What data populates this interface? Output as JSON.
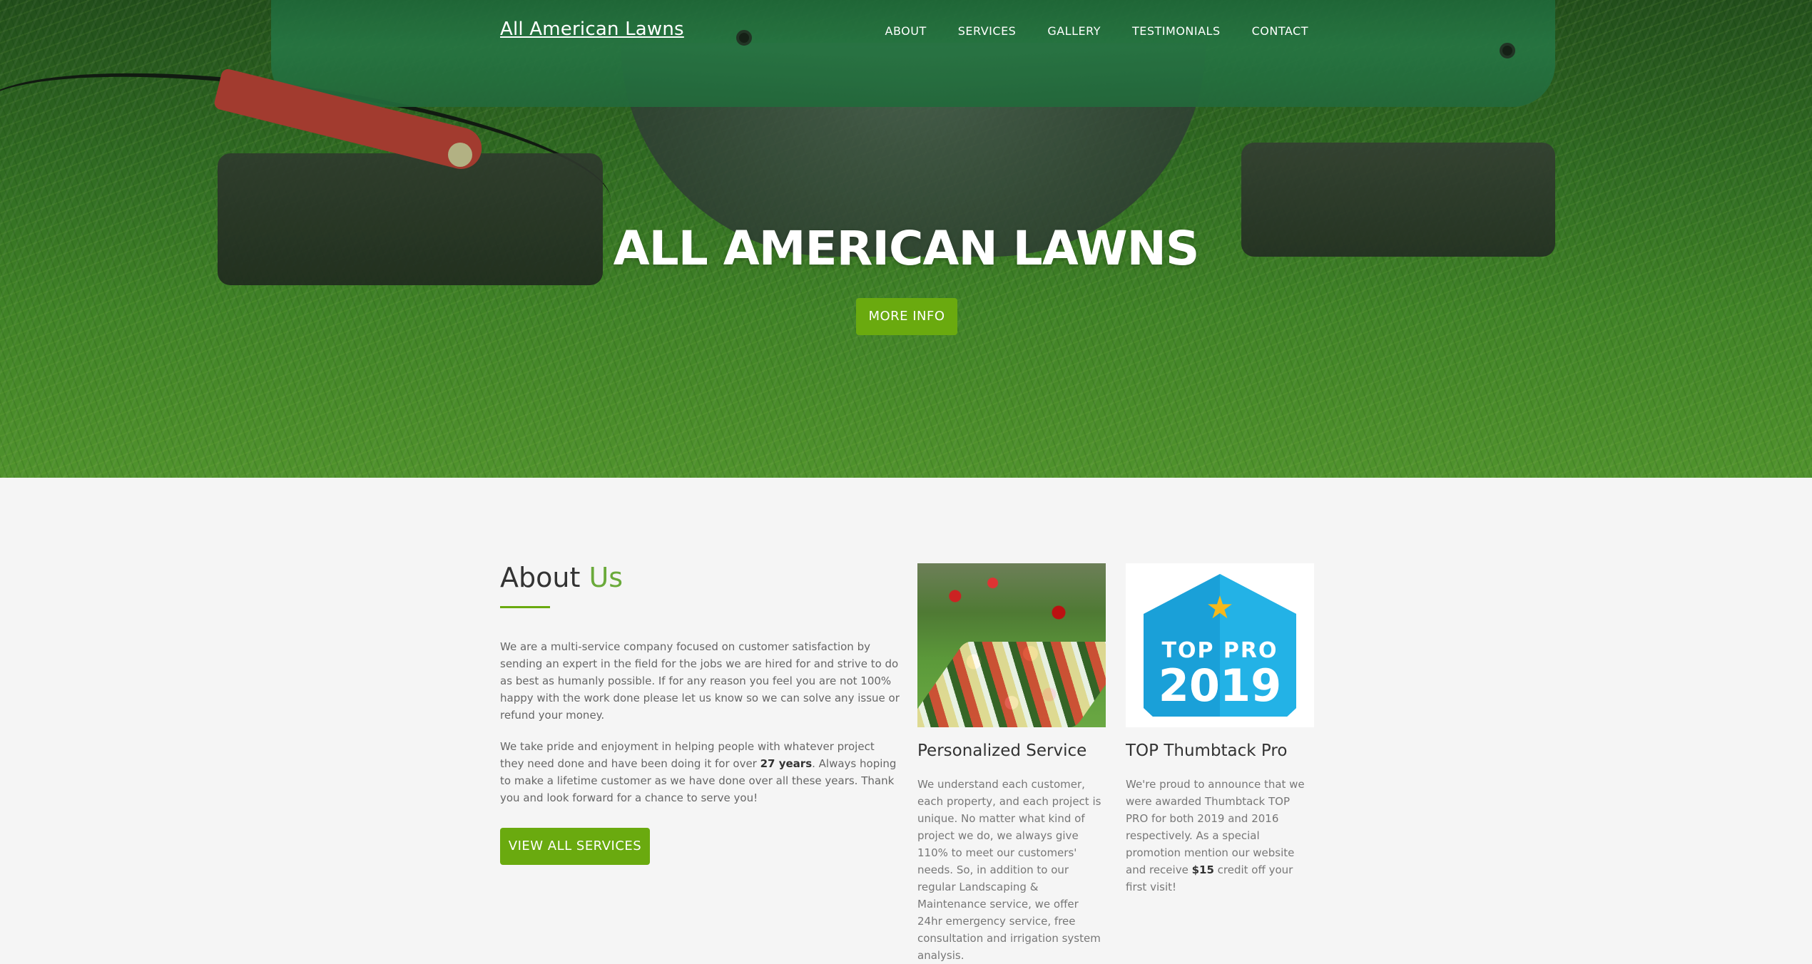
{
  "nav": {
    "brand": "All American Lawns",
    "links": [
      "ABOUT",
      "SERVICES",
      "GALLERY",
      "TESTIMONIALS",
      "CONTACT"
    ]
  },
  "hero": {
    "title": "ALL AMERICAN LAWNS",
    "button": "MORE INFO"
  },
  "about": {
    "heading_main": "About",
    "heading_accent": "Us",
    "p1": "We are a multi-service company focused on customer satisfaction by sending an expert in the field for the jobs we are hired for and strive to do as best as humanly possible. If for any reason you feel you are not 100% happy with the work done please let us know so we can solve any issue or refund your money.",
    "p2_before": "We take pride and enjoyment in helping people with whatever project they need done and have been doing it for over ",
    "p2_bold": "27 years",
    "p2_after": ". Always hoping to make a lifetime customer as we have done over all these years. Thank you and look forward for a chance to serve you!",
    "button": "VIEW ALL SERVICES"
  },
  "cards": [
    {
      "title": "Personalized Service",
      "text": "We understand each customer, each property, and each project is unique. No matter what kind of project we do, we always give 110% to meet our customers' needs. So, in addition to our regular Landscaping & Maintenance service, we offer 24hr emergency service, free consultation and irrigation system analysis."
    },
    {
      "title": "TOP Thumbtack Pro",
      "text_before": "We're proud to announce that we were awarded Thumbtack TOP PRO for both 2019 and 2016 respectively. As a special promotion mention our website and receive ",
      "text_bold": "$15",
      "text_after": " credit off your first visit!",
      "badge_top": "TOP PRO",
      "badge_year": "2019",
      "badge_star": "★"
    }
  ],
  "colors": {
    "accent_green": "#6aaa0f",
    "heading_accent": "#6aaa3a",
    "badge_blue": "#1aa0d8",
    "badge_star": "#f5b91c"
  }
}
